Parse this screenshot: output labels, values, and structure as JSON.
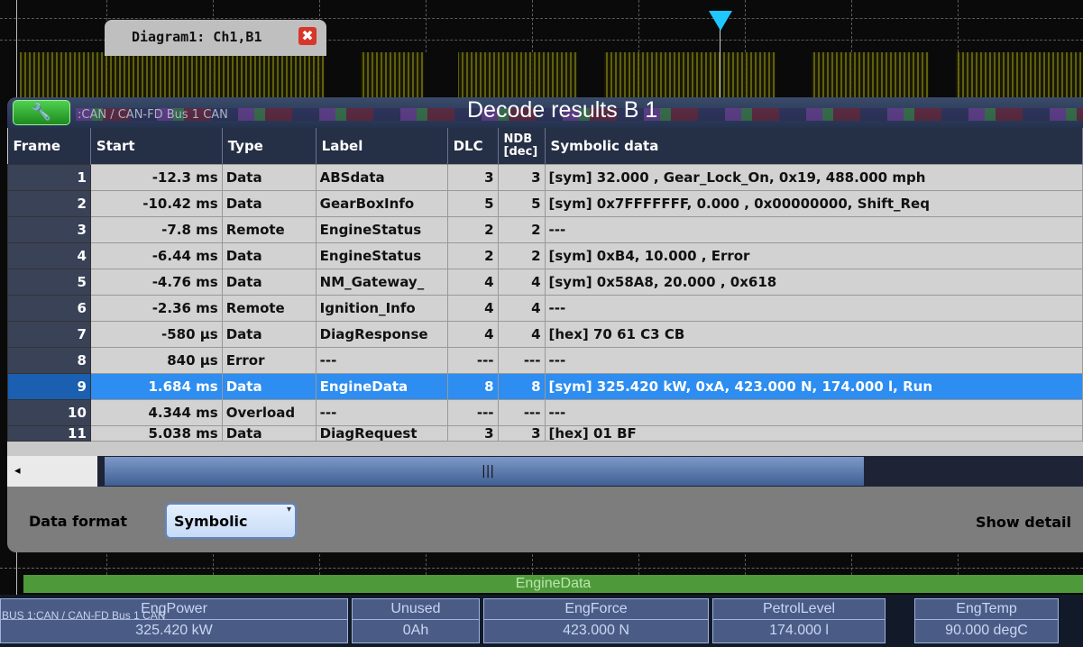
{
  "diagram_tab": {
    "label": "Diagram1: Ch1,B1",
    "close_glyph": "✖"
  },
  "decode": {
    "title": "Decode results B 1",
    "bus_caption": ":CAN / CAN-FD Bus 1 CAN",
    "wrench_glyph": "🔧"
  },
  "table": {
    "headers": {
      "frame": "Frame",
      "start": "Start",
      "type": "Type",
      "label": "Label",
      "dlc": "DLC",
      "ndb_line1": "NDB",
      "ndb_line2": "[dec]",
      "symbolic": "Symbolic data"
    },
    "rows": [
      {
        "frame": "1",
        "start": "-12.3 ms",
        "type": "Data",
        "label": "ABSdata",
        "dlc": "3",
        "ndb": "3",
        "symbolic": "[sym] 32.000 , Gear_Lock_On, 0x19, 488.000 mph"
      },
      {
        "frame": "2",
        "start": "-10.42 ms",
        "type": "Data",
        "label": "GearBoxInfo",
        "dlc": "5",
        "ndb": "5",
        "symbolic": "[sym] 0x7FFFFFFF, 0.000 , 0x00000000, Shift_Req"
      },
      {
        "frame": "3",
        "start": "-7.8 ms",
        "type": "Remote",
        "label": "EngineStatus",
        "dlc": "2",
        "ndb": "2",
        "symbolic": "---"
      },
      {
        "frame": "4",
        "start": "-6.44 ms",
        "type": "Data",
        "label": "EngineStatus",
        "dlc": "2",
        "ndb": "2",
        "symbolic": "[sym] 0xB4, 10.000 , Error"
      },
      {
        "frame": "5",
        "start": "-4.76 ms",
        "type": "Data",
        "label": "NM_Gateway_",
        "dlc": "4",
        "ndb": "4",
        "symbolic": "[sym] 0x58A8, 20.000 , 0x618"
      },
      {
        "frame": "6",
        "start": "-2.36 ms",
        "type": "Remote",
        "label": "Ignition_Info",
        "dlc": "4",
        "ndb": "4",
        "symbolic": "---"
      },
      {
        "frame": "7",
        "start": "-580 µs",
        "type": "Data",
        "label": "DiagResponse",
        "dlc": "4",
        "ndb": "4",
        "symbolic": "[hex] 70 61 C3 CB"
      },
      {
        "frame": "8",
        "start": "840 µs",
        "type": "Error",
        "label": "---",
        "dlc": "---",
        "ndb": "---",
        "symbolic": "---"
      },
      {
        "frame": "9",
        "start": "1.684 ms",
        "type": "Data",
        "label": "EngineData",
        "dlc": "8",
        "ndb": "8",
        "symbolic": "[sym] 325.420 kW, 0xA, 423.000 N, 174.000 l, Run"
      },
      {
        "frame": "10",
        "start": "4.344 ms",
        "type": "Overload",
        "label": "---",
        "dlc": "---",
        "ndb": "---",
        "symbolic": "---"
      },
      {
        "frame": "11",
        "start": "5.038 ms",
        "type": "Data",
        "label": "DiagRequest",
        "dlc": "3",
        "ndb": "3",
        "symbolic": "[hex] 01 BF"
      }
    ],
    "selected_frame": "9"
  },
  "scrollbar": {
    "left_arrow": "◂",
    "grip": "|||"
  },
  "footer": {
    "data_format_label": "Data format",
    "data_format_value": "Symbolic",
    "dropdown_glyph": "▾",
    "show_details_label": "Show detail"
  },
  "bottom_bar": {
    "frame_label": "EngineData",
    "bus_label": "BUS 1:CAN / CAN-FD Bus 1 CAN",
    "fields": [
      {
        "name": "EngPower",
        "value": "325.420 kW"
      },
      {
        "name": "Unused",
        "value": "0Ah"
      },
      {
        "name": "EngForce",
        "value": "423.000 N"
      },
      {
        "name": "PetrolLevel",
        "value": "174.000 l"
      },
      {
        "name": "EngTemp",
        "value": "90.000 degC"
      }
    ]
  },
  "colors": {
    "selection": "#2d8df0",
    "header": "#252f45",
    "trigger": "#1ec8ff",
    "frame_bar": "#4e9a3a"
  }
}
